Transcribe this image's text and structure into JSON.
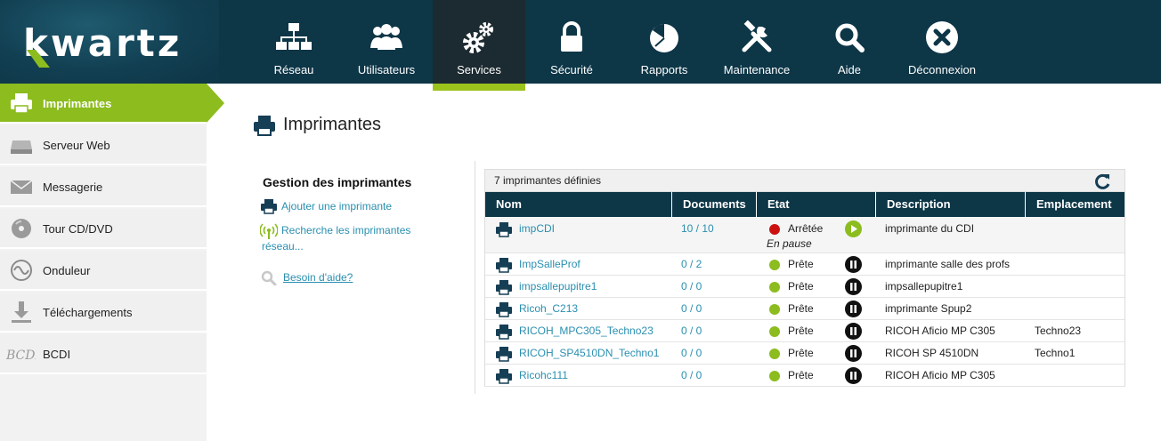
{
  "app": {
    "logo_text": "kwartz"
  },
  "nav": [
    {
      "label": "Réseau",
      "icon": "network-icon"
    },
    {
      "label": "Utilisateurs",
      "icon": "users-icon"
    },
    {
      "label": "Services",
      "icon": "gears-icon",
      "active": true
    },
    {
      "label": "Sécurité",
      "icon": "lock-icon"
    },
    {
      "label": "Rapports",
      "icon": "pie-chart-icon"
    },
    {
      "label": "Maintenance",
      "icon": "tools-icon"
    },
    {
      "label": "Aide",
      "icon": "search-icon"
    },
    {
      "label": "Déconnexion",
      "icon": "close-circle-icon"
    }
  ],
  "sidebar": {
    "items": [
      {
        "label": "Imprimantes",
        "icon": "printer-icon",
        "active": true
      },
      {
        "label": "Serveur Web",
        "icon": "server-icon"
      },
      {
        "label": "Messagerie",
        "icon": "envelope-icon"
      },
      {
        "label": "Tour CD/DVD",
        "icon": "disc-icon"
      },
      {
        "label": "Onduleur",
        "icon": "sine-wave-icon"
      },
      {
        "label": "Téléchargements",
        "icon": "download-icon"
      },
      {
        "label": "BCDI",
        "icon": "bcdi-logo-icon"
      }
    ]
  },
  "main": {
    "title": "Imprimantes",
    "actions": {
      "title": "Gestion des imprimantes",
      "add": "Ajouter une imprimante",
      "search_line1": "Recherche les imprimantes",
      "search_line2": "réseau...",
      "help": "Besoin d'aide?"
    },
    "table": {
      "caption": "7 imprimantes définies",
      "columns": [
        "Nom",
        "Documents",
        "Etat",
        "Description",
        "Emplacement"
      ],
      "rows": [
        {
          "name": "impCDI",
          "documents": "10 / 10",
          "state": "Arrêtée",
          "substate": "En pause",
          "status": "stopped",
          "control": "play",
          "description": "imprimante du CDI",
          "location": ""
        },
        {
          "name": "ImpSalleProf",
          "documents": "0 / 2",
          "state": "Prête",
          "status": "ready",
          "control": "pause",
          "description": "imprimante salle des profs",
          "location": ""
        },
        {
          "name": "impsallepupitre1",
          "documents": "0 / 0",
          "state": "Prête",
          "status": "ready",
          "control": "pause",
          "description": "impsallepupitre1",
          "location": ""
        },
        {
          "name": "Ricoh_C213",
          "documents": "0 / 0",
          "state": "Prête",
          "status": "ready",
          "control": "pause",
          "description": "imprimante Spup2",
          "location": ""
        },
        {
          "name": "RICOH_MPC305_Techno23",
          "documents": "0 / 0",
          "state": "Prête",
          "status": "ready",
          "control": "pause",
          "description": "RICOH Aficio MP C305",
          "location": "Techno23"
        },
        {
          "name": "RICOH_SP4510DN_Techno1",
          "documents": "0 / 0",
          "state": "Prête",
          "status": "ready",
          "control": "pause",
          "description": "RICOH SP 4510DN",
          "location": "Techno1"
        },
        {
          "name": "Ricohc111",
          "documents": "0 / 0",
          "state": "Prête",
          "status": "ready",
          "control": "pause",
          "description": "RICOH Aficio MP C305",
          "location": ""
        }
      ]
    }
  },
  "colors": {
    "header_bg": "#0d3647",
    "accent": "#8cbc1e",
    "link": "#2a8fb0",
    "stopped": "#cc1111"
  }
}
